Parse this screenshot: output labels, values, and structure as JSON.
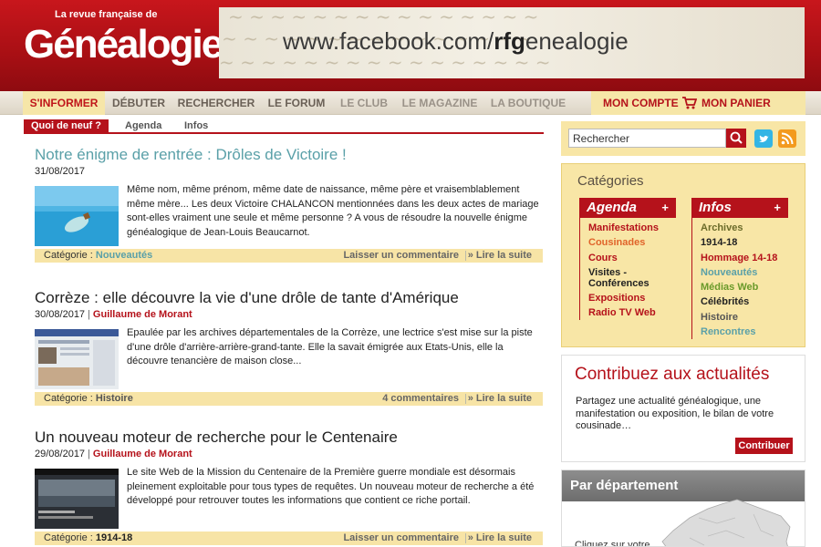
{
  "header": {
    "logo_tagline": "La revue française de",
    "logo_name": "Généalogie",
    "banner_prefix": "www.facebook.com/",
    "banner_bold": "rfg",
    "banner_suffix": "enealogie"
  },
  "nav": {
    "items": [
      {
        "label": "S'INFORMER"
      },
      {
        "label": "DÉBUTER"
      },
      {
        "label": "RECHERCHER"
      },
      {
        "label": "LE FORUM"
      },
      {
        "label": "LE CLUB"
      },
      {
        "label": "LE MAGAZINE"
      },
      {
        "label": "LA BOUTIQUE"
      }
    ],
    "account": "MON COMPTE",
    "cart": "MON PANIER"
  },
  "subnav": {
    "items": [
      {
        "label": "Quoi de neuf ?"
      },
      {
        "label": "Agenda"
      },
      {
        "label": "Infos"
      }
    ]
  },
  "articles": [
    {
      "title": "Notre énigme de rentrée : Drôles de Victoire !",
      "date": "31/08/2017",
      "author": "",
      "text": "Même nom, même prénom, même date de naissance, même père et vraisemblablement même mère... Les deux Victoire CHALANCON mentionnées dans les deux actes de mariage sont-elles vraiment une seule et même personne ? A vous de résoudre la nouvelle énigme généalogique de Jean-Louis Beaucarnot.",
      "category_label": "Catégorie :",
      "category": "Nouveautés",
      "comments": "Laisser un commentaire",
      "read_more": "» Lire la suite"
    },
    {
      "title": "Corrèze : elle découvre la vie d'une drôle de tante d'Amérique",
      "date": "30/08/2017",
      "author": "Guillaume de Morant",
      "text": "Epaulée par les archives départementales de la Corrèze, une lectrice s'est mise sur la piste d'une drôle d'arrière-arrière-grand-tante. Elle la savait émigrée aux Etats-Unis, elle la découvre tenancière de maison close...",
      "category_label": "Catégorie :",
      "category": "Histoire",
      "comments": "4 commentaires",
      "read_more": "» Lire la suite"
    },
    {
      "title": "Un nouveau moteur de recherche pour le Centenaire",
      "date": "29/08/2017",
      "author": "Guillaume de Morant",
      "text": "Le site Web de la Mission du Centenaire de la Première guerre mondiale est désormais pleinement exploitable pour tous types de requêtes. Un nouveau moteur de recherche a été développé pour retrouver toutes les informations que contient ce riche portail.",
      "category_label": "Catégorie :",
      "category": "1914-18",
      "comments": "Laisser un commentaire",
      "read_more": "» Lire la suite"
    }
  ],
  "search": {
    "value": "Rechercher"
  },
  "categories": {
    "title": "Catégories",
    "agenda": {
      "heading": "Agenda",
      "plus": "+",
      "items": [
        {
          "label": "Manifestations",
          "color": "#b5121b"
        },
        {
          "label": "Cousinades",
          "color": "#e0642a"
        },
        {
          "label": "Cours",
          "color": "#b5121b"
        },
        {
          "label": "Visites -",
          "color": "#222222"
        },
        {
          "label": "Conférences",
          "color": "#222222"
        },
        {
          "label": "Expositions",
          "color": "#b5121b"
        },
        {
          "label": "Radio TV Web",
          "color": "#b5121b"
        }
      ]
    },
    "infos": {
      "heading": "Infos",
      "plus": "+",
      "items": [
        {
          "label": "Archives",
          "color": "#6b6b2a"
        },
        {
          "label": "1914-18",
          "color": "#222222"
        },
        {
          "label": "Hommage 14-18",
          "color": "#b5121b"
        },
        {
          "label": "Nouveautés",
          "color": "#5aa0a8"
        },
        {
          "label": "Médias Web",
          "color": "#6a9a2a"
        },
        {
          "label": "Célébrités",
          "color": "#222222"
        },
        {
          "label": "Histoire",
          "color": "#555555"
        },
        {
          "label": "Rencontres",
          "color": "#5aa0a8"
        }
      ]
    }
  },
  "contribute": {
    "title": "Contribuez aux actualités",
    "text": "Partagez une actualité généalogique, une manifestation ou exposition, le bilan de votre cousinade…",
    "button": "Contribuer"
  },
  "departement": {
    "title": "Par département",
    "text": "Cliquez sur votre"
  },
  "colors": {
    "brand_red": "#b5121b",
    "nav_active_bg": "#f6e6a6",
    "teal": "#5aa0a8"
  }
}
